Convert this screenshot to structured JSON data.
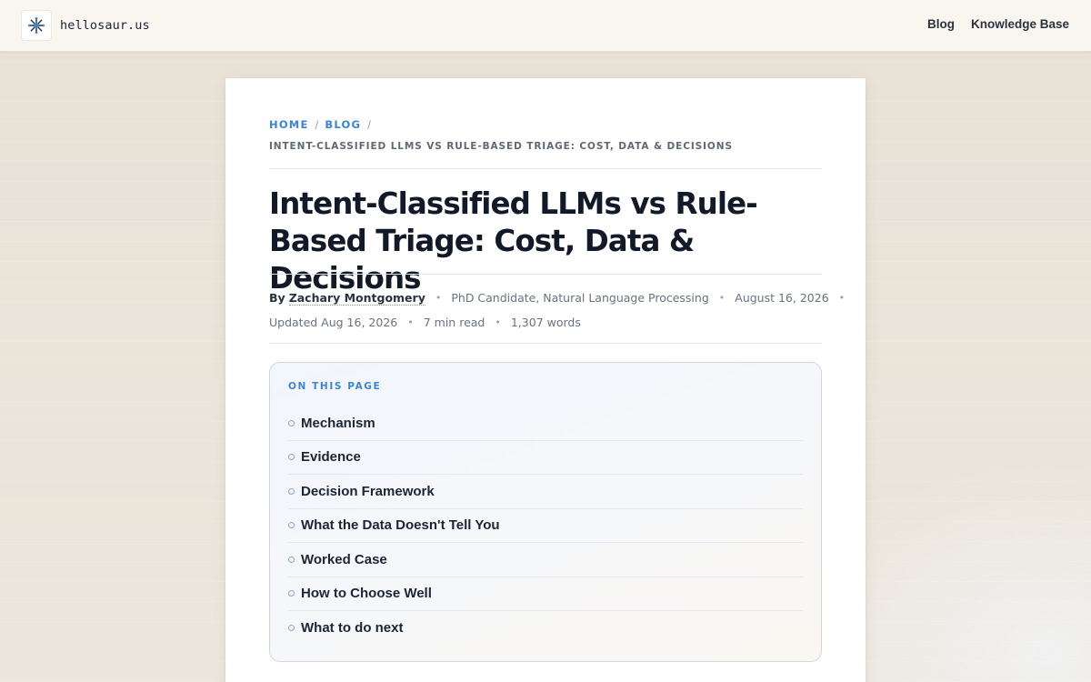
{
  "header": {
    "brand": "hellosaur.us",
    "nav": [
      "Blog",
      "Knowledge Base"
    ]
  },
  "breadcrumb": {
    "home": "HOME",
    "blog": "BLOG",
    "separator": "/",
    "current": "INTENT-CLASSIFIED LLMS VS RULE-BASED TRIAGE: COST, DATA & DECISIONS"
  },
  "article": {
    "title": "Intent-Classified LLMs vs Rule-Based Triage: Cost, Data & Decisions",
    "byline_prefix": "By",
    "author": "Zachary Montgomery",
    "author_role": "PhD Candidate, Natural Language Processing",
    "published": "August 16, 2026",
    "updated": "Updated Aug 16, 2026",
    "read_time": "7 min read",
    "word_count": "1,307 words",
    "meta_separator": "•"
  },
  "toc": {
    "label": "ON THIS PAGE",
    "items": [
      "Mechanism",
      "Evidence",
      "Decision Framework",
      "What the Data Doesn't Tell You",
      "Worked Case",
      "How to Choose Well",
      "What to do next"
    ]
  },
  "colors": {
    "accent": "#3b84d8",
    "page_background": "#ebe6dc",
    "header_background": "#f9f6f0",
    "title_text": "#121a2a"
  },
  "icons": {
    "brand_logo": "snowflake-spark-icon",
    "toc_bullet": "circle-bullet-icon"
  }
}
